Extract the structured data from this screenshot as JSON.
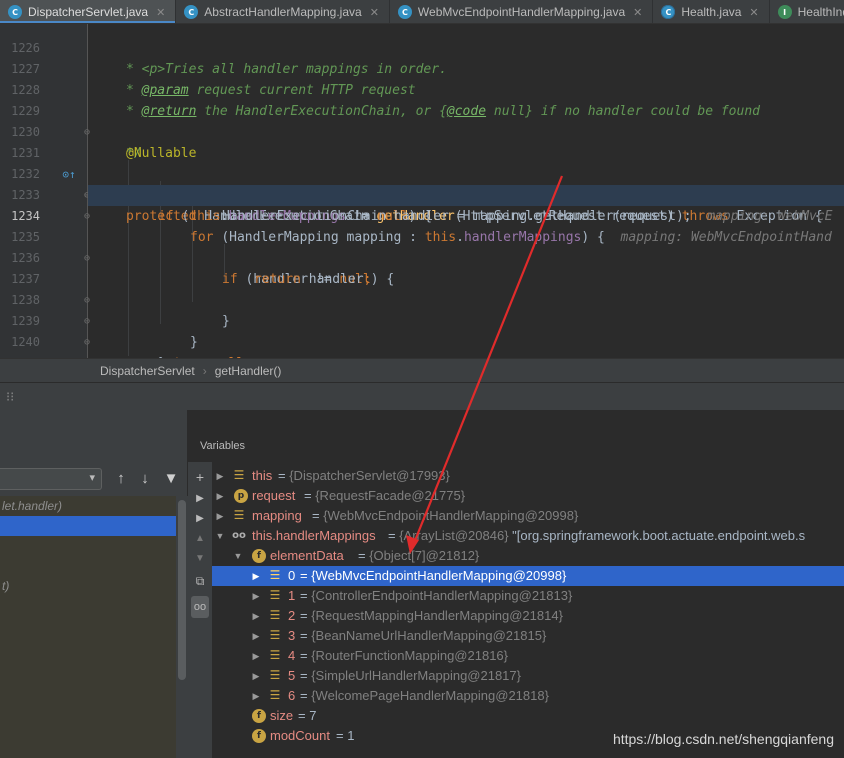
{
  "tabs": [
    {
      "label": "DispatcherServlet.java",
      "icon": "c",
      "active": true
    },
    {
      "label": "AbstractHandlerMapping.java",
      "icon": "c",
      "active": false
    },
    {
      "label": "WebMvcEndpointHandlerMapping.java",
      "icon": "c",
      "active": false
    },
    {
      "label": "Health.java",
      "icon": "c",
      "active": false
    },
    {
      "label": "HealthIndicat",
      "icon": "i",
      "active": false
    }
  ],
  "editor": {
    "current_line": "1234",
    "lines": [
      {
        "num": "1226",
        "text": "* <p>Tries all handler mappings in order."
      },
      {
        "num": "1227",
        "text": "* @param request current HTTP request"
      },
      {
        "num": "1228",
        "text": "* @return the HandlerExecutionChain, or {@code null} if no handler could be found"
      },
      {
        "num": "1229",
        "text": "*/"
      },
      {
        "num": "1230",
        "text": "@Nullable"
      },
      {
        "num": "1231",
        "text": "protected HandlerExecutionChain getHandler(HttpServletRequest request) throws Exception {"
      },
      {
        "num": "1232",
        "text": "if (this.handlerMappings != null) {"
      },
      {
        "num": "1233",
        "text": "for (HandlerMapping mapping : this.handlerMappings) {",
        "hint": "mapping: WebMvcEndpointHand"
      },
      {
        "num": "1234",
        "text": "HandlerExecutionChain handler = mapping.getHandler(request);",
        "hint": "mapping: WebMvcE"
      },
      {
        "num": "1235",
        "text": "if (handler != null) {"
      },
      {
        "num": "1236",
        "text": "return handler;"
      },
      {
        "num": "1237",
        "text": "}"
      },
      {
        "num": "1238",
        "text": "}"
      },
      {
        "num": "1239",
        "text": "}"
      },
      {
        "num": "1240",
        "text": "return null;"
      },
      {
        "num": "1241",
        "text": "}"
      }
    ]
  },
  "breadcrumb": {
    "class": "DispatcherServlet",
    "method": "getHandler()"
  },
  "frames": {
    "items": [
      "let.handler)",
      "",
      "",
      "",
      "t)"
    ]
  },
  "variables": {
    "title": "Variables",
    "rows": [
      {
        "name": "this",
        "value": "{DispatcherServlet@17993}"
      },
      {
        "name": "request",
        "value": "{RequestFacade@21775}"
      },
      {
        "name": "mapping",
        "value": "{WebMvcEndpointHandlerMapping@20998}"
      },
      {
        "name": "this.handlerMappings",
        "ref": "{ArrayList@20846}",
        "value": "\"[org.springframework.boot.actuate.endpoint.web.s"
      },
      {
        "name": "elementData",
        "value": "{Object[7]@21812}"
      },
      {
        "name": "0",
        "value": "{WebMvcEndpointHandlerMapping@20998}"
      },
      {
        "name": "1",
        "value": "{ControllerEndpointHandlerMapping@21813}"
      },
      {
        "name": "2",
        "value": "{RequestMappingHandlerMapping@21814}"
      },
      {
        "name": "3",
        "value": "{BeanNameUrlHandlerMapping@21815}"
      },
      {
        "name": "4",
        "value": "{RouterFunctionMapping@21816}"
      },
      {
        "name": "5",
        "value": "{SimpleUrlHandlerMapping@21817}"
      },
      {
        "name": "6",
        "value": "{WelcomePageHandlerMapping@21818}"
      },
      {
        "name": "size",
        "value": "7"
      },
      {
        "name": "modCount",
        "value": "1"
      }
    ]
  },
  "watermark": "https://blog.csdn.net/shengqianfeng",
  "colors": {
    "selection": "#2f65ca",
    "arrow": "#e02b2b",
    "current_line": "#2d3d50"
  }
}
